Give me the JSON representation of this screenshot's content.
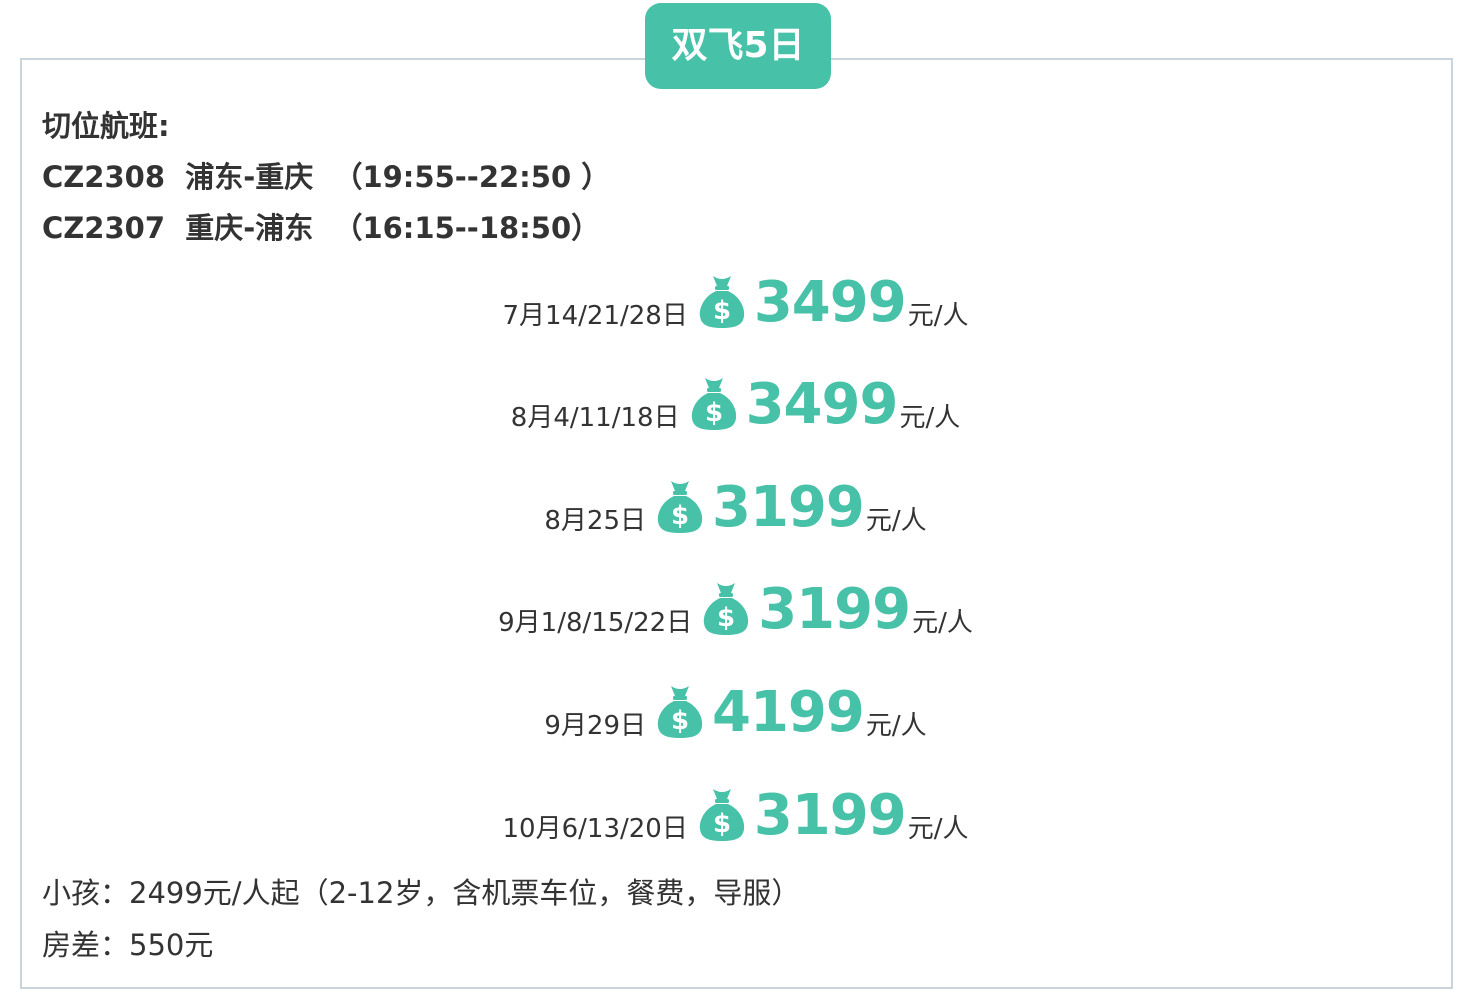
{
  "badge": "双飞5日",
  "flights": {
    "title": "切位航班:",
    "lines": [
      "CZ2308  浦东-重庆  （19:55--22:50 ）",
      "CZ2307  重庆-浦东  （16:15--18:50）"
    ]
  },
  "prices": [
    {
      "date": "7月14/21/28日",
      "price": "3499",
      "unit": "元/人"
    },
    {
      "date": "8月4/11/18日",
      "price": "3499",
      "unit": "元/人"
    },
    {
      "date": "8月25日",
      "price": "3199",
      "unit": "元/人"
    },
    {
      "date": "9月1/8/15/22日",
      "price": "3199",
      "unit": "元/人"
    },
    {
      "date": "9月29日",
      "price": "4199",
      "unit": "元/人"
    },
    {
      "date": "10月6/13/20日",
      "price": "3199",
      "unit": "元/人"
    }
  ],
  "notes": {
    "child": "小孩：2499元/人起（2-12岁，含机票车位，餐费，导服）",
    "room": "房差：550元"
  },
  "colors": {
    "accent": "#47c1a7",
    "text": "#333333",
    "border": "#c9d4dc"
  },
  "icons": {
    "price": "money-bag-icon"
  }
}
